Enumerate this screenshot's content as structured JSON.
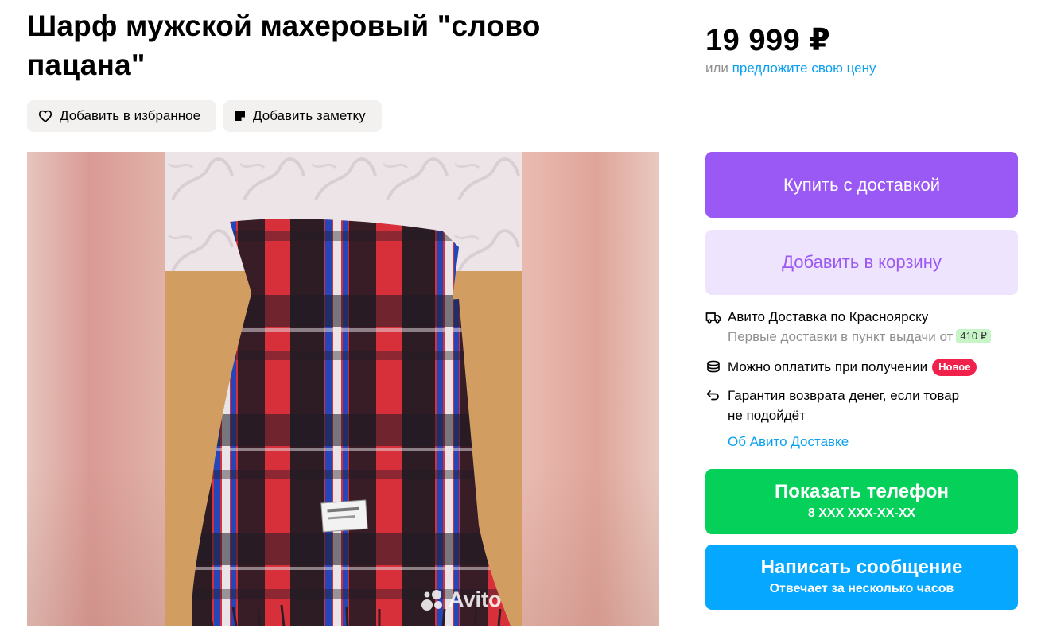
{
  "listing": {
    "title": "Шарф мужской махеровый \"слово пацана\""
  },
  "actions": {
    "favorite_label": "Добавить в избранное",
    "note_label": "Добавить заметку"
  },
  "gallery": {
    "watermark": "Avito",
    "label_text": "",
    "icons": [
      "heart-icon",
      "note-icon"
    ]
  },
  "price": {
    "value": "19 999 ₽",
    "or_text": "или",
    "offer_link": "предложите свою цену"
  },
  "buttons": {
    "buy_label": "Купить с доставкой",
    "cart_label": "Добавить в корзину",
    "phone_label": "Показать телефон",
    "phone_number": "8 XXX XXX-XX-XX",
    "message_label": "Написать сообщение",
    "message_sub": "Отвечает за несколько часов"
  },
  "delivery": {
    "title": "Авито Доставка по Красноярску",
    "subtitle": "Первые доставки в пункт выдачи от",
    "price_tag": "410 ₽",
    "payment": "Можно оплатить при получении",
    "new_badge": "Новое",
    "guarantee_line1": "Гарантия возврата денег, если товар",
    "guarantee_line2": "не подойдёт",
    "about_link": "Об Авито Доставке"
  },
  "colors": {
    "purple": "#9a58f5",
    "light_purple": "#efe4fe",
    "green": "#04d05a",
    "blue": "#06a8ff",
    "link": "#0aa0f0",
    "badge_red": "#f0224b",
    "tag_green": "#c7f5c8"
  }
}
